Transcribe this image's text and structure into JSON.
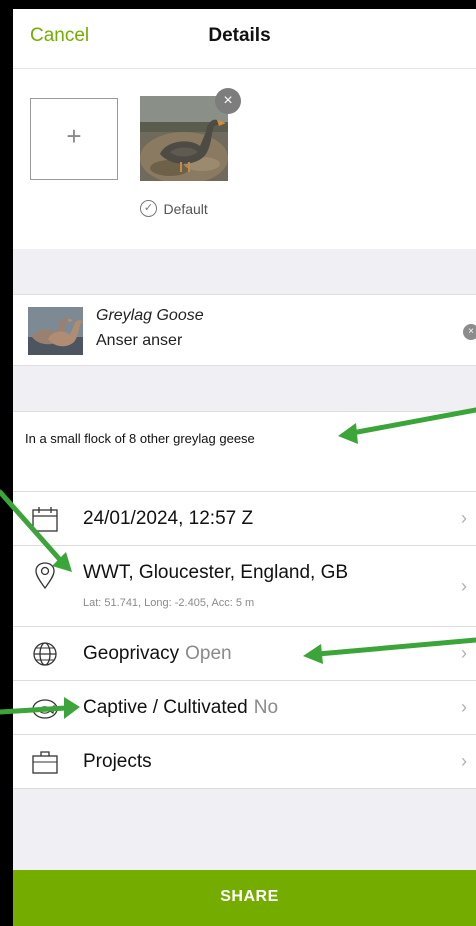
{
  "nav": {
    "cancel_label": "Cancel",
    "title": "Details"
  },
  "photos": {
    "add_symbol": "+",
    "remove_symbol": "×",
    "default_label": "Default",
    "default_check": "✓"
  },
  "species": {
    "common_name": "Greylag Goose",
    "scientific_name": "Anser anser",
    "clear_symbol": "×"
  },
  "notes": {
    "text": "In a small flock of 8 other greylag geese"
  },
  "rows": {
    "date": {
      "label": "24/01/2024, 12:57 Z",
      "icon": "calendar-icon"
    },
    "location": {
      "label": "WWT, Gloucester, England, GB",
      "details": "Lat: 51.741, Long: -2.405, Acc: 5 m",
      "icon": "location-pin-icon"
    },
    "geoprivacy": {
      "label": "Geoprivacy",
      "value": "Open",
      "icon": "globe-icon"
    },
    "captive": {
      "label": "Captive / Cultivated",
      "value": "No",
      "icon": "captive-icon"
    },
    "projects": {
      "label": "Projects",
      "icon": "briefcase-icon"
    },
    "chevron": "›"
  },
  "share": {
    "label": "SHARE"
  },
  "colors": {
    "accent": "#74ac00",
    "annotation_arrow": "#3ba53a",
    "section_gap": "#efeff4"
  }
}
